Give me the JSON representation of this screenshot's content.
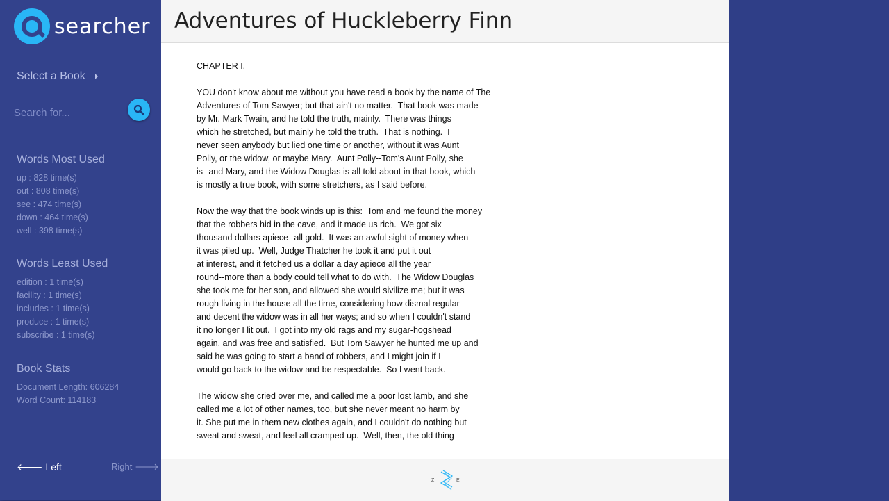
{
  "app": {
    "logo_text": "searcher",
    "accent": "#29b6f6",
    "sidebar_bg": "#33428c",
    "page_bg": "#2f3e87"
  },
  "sidebar": {
    "select_book_label": "Select a Book",
    "search_placeholder": "Search for...",
    "search_value": "",
    "most_used_title": "Words Most Used",
    "most_used": [
      "up : 828 time(s)",
      "out : 808 time(s)",
      "see : 474 time(s)",
      "down : 464 time(s)",
      "well : 398 time(s)"
    ],
    "least_used_title": "Words Least Used",
    "least_used": [
      "edition : 1 time(s)",
      "facility : 1 time(s)",
      "includes : 1 time(s)",
      "produce : 1 time(s)",
      "subscribe : 1 time(s)"
    ],
    "stats_title": "Book Stats",
    "stats": [
      "Document Length: 606284",
      "Word Count: 114183"
    ],
    "nav_left": "Left",
    "nav_right": "Right"
  },
  "book": {
    "title": "Adventures of Huckleberry Finn",
    "paragraphs": [
      "CHAPTER I.",
      "YOU don't know about me without you have read a book by the name of The\nAdventures of Tom Sawyer; but that ain't no matter.  That book was made\nby Mr. Mark Twain, and he told the truth, mainly.  There was things\nwhich he stretched, but mainly he told the truth.  That is nothing.  I\nnever seen anybody but lied one time or another, without it was Aunt\nPolly, or the widow, or maybe Mary.  Aunt Polly--Tom's Aunt Polly, she\nis--and Mary, and the Widow Douglas is all told about in that book, which\nis mostly a true book, with some stretchers, as I said before.",
      "Now the way that the book winds up is this:  Tom and me found the money\nthat the robbers hid in the cave, and it made us rich.  We got six\nthousand dollars apiece--all gold.  It was an awful sight of money when\nit was piled up.  Well, Judge Thatcher he took it and put it out\nat interest, and it fetched us a dollar a day apiece all the year\nround--more than a body could tell what to do with.  The Widow Douglas\nshe took me for her son, and allowed she would sivilize me; but it was\nrough living in the house all the time, considering how dismal regular\nand decent the widow was in all her ways; and so when I couldn't stand\nit no longer I lit out.  I got into my old rags and my sugar-hogshead\nagain, and was free and satisfied.  But Tom Sawyer he hunted me up and\nsaid he was going to start a band of robbers, and I might join if I\nwould go back to the widow and be respectable.  So I went back.",
      "The widow she cried over me, and called me a poor lost lamb, and she\ncalled me a lot of other names, too, but she never meant no harm by\nit. She put me in them new clothes again, and I couldn't do nothing but\nsweat and sweat, and feel all cramped up.  Well, then, the old thing"
    ]
  },
  "footer": {
    "logo_left": "Z",
    "logo_right": "E"
  }
}
